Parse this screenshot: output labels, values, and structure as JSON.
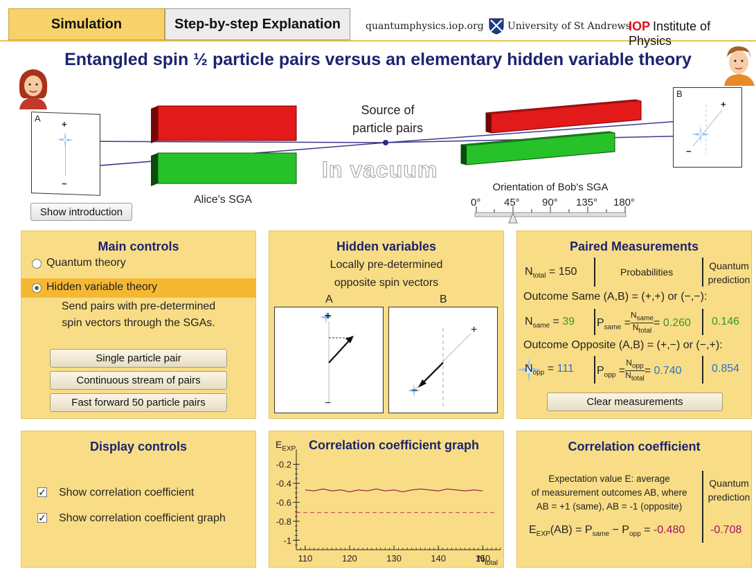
{
  "tabs": {
    "simulation": "Simulation",
    "explanation": "Step-by-step Explanation"
  },
  "header": {
    "site": "quantumphysics.iop.org",
    "university": "University of St Andrews",
    "iop_short": "IOP",
    "iop_long": "Institute of Physics"
  },
  "title": "Entangled spin ½ particle pairs versus an elementary hidden variable theory",
  "scene": {
    "screen_a_label": "A",
    "screen_b_label": "B",
    "plus": "+",
    "minus": "−",
    "source_line1": "Source of",
    "source_line2": "particle pairs",
    "vacuum": "In vacuum",
    "alice_sga": "Alice's SGA",
    "show_intro": "Show introduction",
    "orientation_label": "Orientation of Bob's SGA",
    "orientation_ticks": [
      "0°",
      "45°",
      "90°",
      "135°",
      "180°"
    ],
    "bob_orientation_deg": 45
  },
  "main_controls": {
    "title": "Main controls",
    "option_quantum": "Quantum theory",
    "option_hidden": "Hidden variable theory",
    "selected": "hidden",
    "desc_line1": "Send pairs with pre-determined",
    "desc_line2": "spin vectors through the SGAs.",
    "btn_single": "Single particle pair",
    "btn_stream": "Continuous stream of pairs",
    "btn_fast": "Fast forward 50 particle pairs"
  },
  "hidden_vars": {
    "title": "Hidden variables",
    "line1": "Locally pre-determined",
    "line2": "opposite spin vectors",
    "label_a": "A",
    "label_b": "B",
    "plus": "+",
    "minus": "−"
  },
  "paired": {
    "title": "Paired Measurements",
    "n_total_label": "N",
    "n_total_sub": "total",
    "n_total_value": "150",
    "probabilities": "Probabilities",
    "quantum_line1": "Quantum",
    "quantum_line2": "prediction",
    "outcome_same": "Outcome Same (A,B) = (+,+) or (−,−):",
    "n_same_sub": "same",
    "n_same_value": "39",
    "p_same_sub": "same",
    "p_same_value": "0.260",
    "q_same_value": "0.146",
    "outcome_opp": "Outcome Opposite (A,B) = (+,−) or (−,+):",
    "n_opp_sub": "opp",
    "n_opp_value": "111",
    "p_opp_sub": "opp",
    "p_opp_value": "0.740",
    "q_opp_value": "0.854",
    "clear_btn": "Clear measurements"
  },
  "display_controls": {
    "title": "Display controls",
    "opt1": "Show correlation coefficient",
    "opt2": "Show correlation coefficient graph",
    "opt1_checked": true,
    "opt2_checked": true
  },
  "chart_data": {
    "type": "line",
    "title": "Correlation coefficient graph",
    "ylabel": "E",
    "ylabel_sub": "EXP",
    "xlabel": "N",
    "xlabel_sub": "total",
    "xlim": [
      108,
      122
    ],
    "ylim": [
      -1.1,
      -0.1
    ],
    "x_ticks": [
      110,
      120,
      130,
      140,
      150
    ],
    "y_ticks": [
      -0.2,
      -0.4,
      -0.6,
      -0.8,
      -1
    ],
    "y_tick_labels": [
      "-0.2",
      "-0.4",
      "-0.6",
      "-0.8",
      "-1"
    ],
    "series": [
      {
        "x": [
          110,
          112,
          114,
          116,
          118,
          120,
          122,
          124,
          126,
          128,
          130,
          132,
          134,
          136,
          138,
          140,
          142,
          144,
          146,
          148,
          150
        ],
        "y": [
          -0.47,
          -0.48,
          -0.46,
          -0.48,
          -0.47,
          -0.49,
          -0.47,
          -0.48,
          -0.46,
          -0.48,
          -0.47,
          -0.49,
          -0.47,
          -0.46,
          -0.47,
          -0.48,
          -0.46,
          -0.47,
          -0.48,
          -0.47,
          -0.48
        ],
        "color": "#8a1a3a"
      }
    ],
    "reference_line": {
      "y": -0.708,
      "color": "#c0405a",
      "style": "dashed"
    }
  },
  "correlation": {
    "title": "Correlation coefficient",
    "desc1": "Expectation value E: average",
    "desc2": "of measurement outcomes AB, where",
    "desc3": "AB = +1 (same), AB = -1 (opposite)",
    "quantum_line1": "Quantum",
    "quantum_line2": "prediction",
    "e_label": "E",
    "e_sub": "EXP",
    "e_expr": "(AB) = P",
    "p_same_sub": "same",
    "minus_p": " − P",
    "p_opp_sub": "opp",
    "equals": " = ",
    "e_value": "-0.480",
    "q_value": "-0.708"
  },
  "colors": {
    "panel": "#f9dd86",
    "title_blue": "#1a2470",
    "green": "#2e9b2a",
    "blue": "#2674c9",
    "maroon": "#a3105e"
  }
}
